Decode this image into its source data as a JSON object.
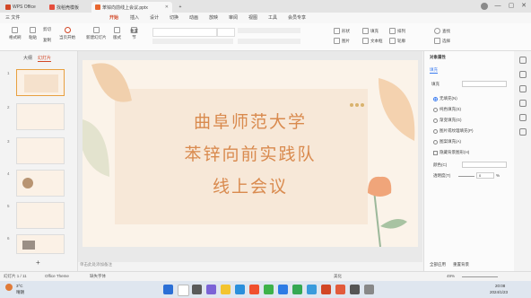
{
  "tabs": [
    {
      "label": "WPS Office"
    },
    {
      "label": "找稻壳模板"
    },
    {
      "label": "苯锌向前线上会议.pptx"
    }
  ],
  "new_tab": "+",
  "window_controls": {
    "minimize": "—",
    "maximize": "▢",
    "close": "✕"
  },
  "menu": {
    "file": "三 文件",
    "items": [
      "开始",
      "插入",
      "设计",
      "切换",
      "动画",
      "放映",
      "审阅",
      "视图",
      "工具",
      "会员专享"
    ]
  },
  "toolbar": {
    "format_painter": "格式刷",
    "paste": "粘贴",
    "cut": "剪切",
    "copy": "复制",
    "play_from": "当页开始",
    "new_slide": "新建幻灯片",
    "layout": "版式",
    "section": "节",
    "reset": "重置",
    "shape": "形状",
    "picture": "图片",
    "fill": "填充",
    "textbox": "文本框",
    "arrange": "排列",
    "outline": "轮廓",
    "find": "查找",
    "select": "选择"
  },
  "leftpanel": {
    "tab_outline": "大纲",
    "tab_slides": "幻灯片",
    "slide_numbers": [
      "1",
      "2",
      "3",
      "4",
      "5",
      "6"
    ],
    "add": "+"
  },
  "slide": {
    "line1": "曲阜师范大学",
    "line2": "苯锌向前实践队",
    "line3": "线上会议"
  },
  "notes": "单击此处添加备注",
  "rightpane": {
    "title": "对象属性",
    "tab": "填充",
    "section": "填充",
    "options": [
      "无填充(N)",
      "纯色填充(S)",
      "渐变填充(G)",
      "图片或纹理填充(P)",
      "图案填充(A)"
    ],
    "hide_bg": "隐藏背景图形(H)",
    "color_label": "颜色(C)",
    "transparency_label": "透明度(T)",
    "transparency_value": "0",
    "percent": "%",
    "apply_all": "全部应用",
    "reset_bg": "重置背景"
  },
  "statusbar": {
    "slide_pos": "幻灯片 1 / 11",
    "theme": "Office Theme",
    "font_missing": "缺失字体",
    "beautify": "美化",
    "zoom": "49%"
  },
  "taskbar": {
    "weather_temp": "3°C",
    "weather_desc": "晴朗",
    "time": "20:08",
    "date": "2024/1/23"
  },
  "colors": {
    "accent": "#d24726",
    "slide_bg": "#fbf3e9",
    "slide_text": "#d98a4e",
    "leaf": "#efc9a3",
    "flower": "#f0a57a",
    "stem": "#9cb89a"
  }
}
